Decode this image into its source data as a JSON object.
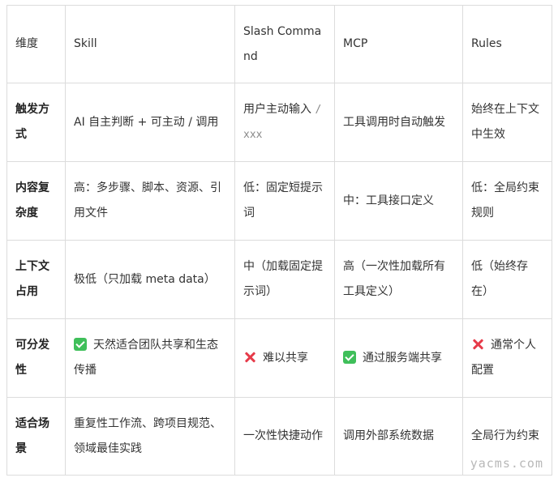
{
  "table": {
    "header": [
      "维度",
      "Skill",
      "Slash Command",
      "MCP",
      "Rules"
    ],
    "rows": [
      {
        "label": "触发方式",
        "skill": "AI 自主判断 + 可主动 / 调用",
        "slash_text": "用户主动输入 ",
        "slash_code": "/xxx",
        "mcp": "工具调用时自动触发",
        "rules": "始终在上下文中生效"
      },
      {
        "label": "内容复杂度",
        "skill": "高：多步骤、脚本、资源、引用文件",
        "slash": "低：固定短提示词",
        "mcp": "中：工具接口定义",
        "rules": "低：全局约束规则"
      },
      {
        "label": "上下文占用",
        "skill": "极低（只加载 meta data）",
        "slash": "中（加载固定提示词）",
        "mcp": "高（一次性加载所有工具定义）",
        "rules": "低（始终存在）"
      },
      {
        "label": "可分发性",
        "skill": "天然适合团队共享和生态传播",
        "skill_icon": "check-icon",
        "slash": "难以共享",
        "slash_icon": "cross-icon",
        "mcp": "通过服务端共享",
        "mcp_icon": "check-icon",
        "rules": "通常个人配置",
        "rules_icon": "cross-icon"
      },
      {
        "label": "适合场景",
        "skill": "重复性工作流、跨项目规范、领域最佳实践",
        "slash": "一次性快捷动作",
        "mcp": "调用外部系统数据",
        "rules": "全局行为约束"
      }
    ]
  },
  "colors": {
    "check": "#3fbf5a",
    "cross": "#e63b4a",
    "border": "#dcdcdc"
  },
  "watermark": "yacms.com"
}
